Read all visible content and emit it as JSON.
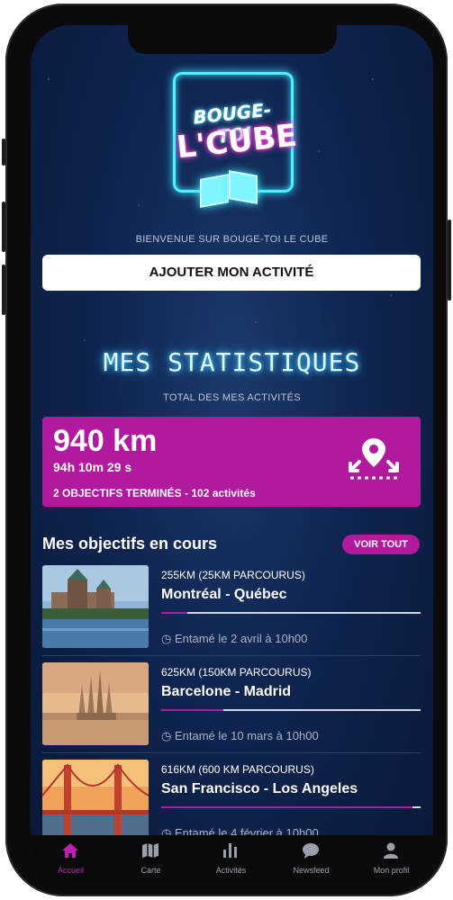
{
  "app": {
    "logo_line1": "BOUGE-TOI",
    "logo_line2": "L'CUBE",
    "welcome": "BIENVENUE SUR BOUGE-TOI LE CUBE",
    "add_activity_label": "AJOUTER MON ACTIVITÉ"
  },
  "stats": {
    "title": "MES STATISTIQUES",
    "subtitle": "TOTAL DES MES ACTIVITÉS",
    "distance": "940 km",
    "duration": "94h 10m 29 s",
    "summary": "2 OBJECTIFS TERMINÉS - 102 activités",
    "icon": "map-route-icon"
  },
  "objectives": {
    "header": "Mes objectifs en cours",
    "see_all_label": "VOIR TOUT",
    "items": [
      {
        "distance": "255KM (25KM PARCOURUS)",
        "name": "Montréal - Québec",
        "progress": 0.1,
        "started": "Entamé le 2 avril à 10h00"
      },
      {
        "distance": "625KM (150KM PARCOURUS)",
        "name": "Barcelone - Madrid",
        "progress": 0.24,
        "started": "Entamé le 10 mars à 10h00"
      },
      {
        "distance": "616KM (600 KM PARCOURUS)",
        "name": "San Francisco - Los Angeles",
        "progress": 0.97,
        "started": "Entamé le 4 février à 10h00"
      }
    ]
  },
  "tabs": [
    {
      "label": "Accueil",
      "icon": "home-icon",
      "active": true
    },
    {
      "label": "Carte",
      "icon": "map-icon",
      "active": false
    },
    {
      "label": "Activités",
      "icon": "bar-chart-icon",
      "active": false
    },
    {
      "label": "Newsfeed",
      "icon": "chat-bubble-icon",
      "active": false
    },
    {
      "label": "Mon profil",
      "icon": "person-icon",
      "active": false
    }
  ],
  "colors": {
    "accent": "#b1199f",
    "background": "#0f2550",
    "neon_cyan": "#4ff0ff",
    "neon_pink": "#ff3fd7"
  }
}
